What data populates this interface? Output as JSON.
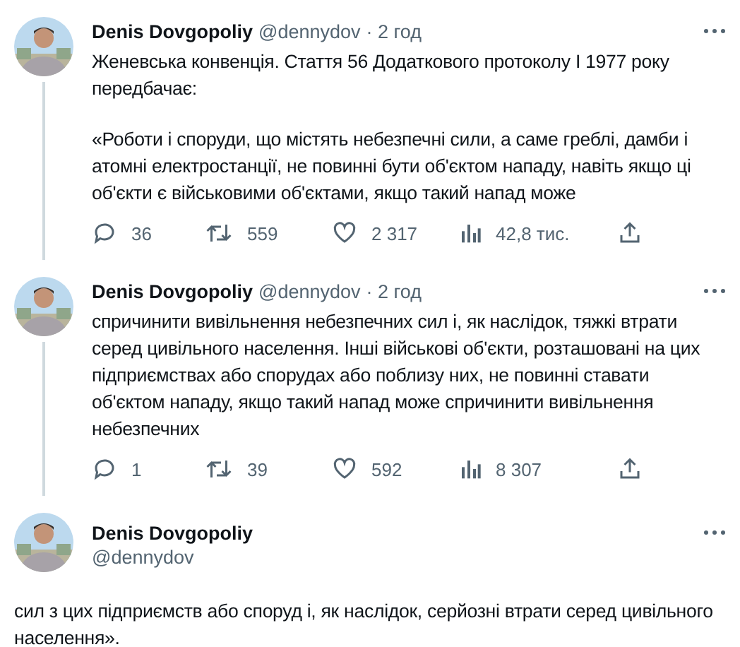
{
  "tweets": [
    {
      "kind": "thread",
      "author": {
        "name": "Denis Dovgopoliy",
        "handle": "@dennydov",
        "time": "· 2 год"
      },
      "paragraphs": [
        "Женевська конвенція. Стаття 56 Додаткового протоколу I 1977 року передбачає:",
        "«Роботи і споруди, що містять небезпечні сили, а саме греблі, дамби і атомні електростанції, не повинні бути об'єктом нападу, навіть якщо ці об'єкти є військовими об'єктами, якщо такий напад може"
      ],
      "actions": [
        {
          "kind": "reply",
          "count": "36"
        },
        {
          "kind": "retweet",
          "count": "559"
        },
        {
          "kind": "like",
          "count": "2 317"
        },
        {
          "kind": "views",
          "count": "42,8 тис."
        },
        {
          "kind": "share"
        }
      ]
    },
    {
      "kind": "thread",
      "author": {
        "name": "Denis Dovgopoliy",
        "handle": "@dennydov",
        "time": "· 2 год"
      },
      "paragraphs": [
        "спричинити вивільнення небезпечних сил і, як наслідок, тяжкі втрати серед цивільного населення. Інші військові об'єкти, розташовані на цих підприємствах або спорудах або поблизу них, не повинні ставати об'єктом нападу, якщо такий напад може спричинити вивільнення небезпечних"
      ],
      "actions": [
        {
          "kind": "reply",
          "count": "1"
        },
        {
          "kind": "retweet",
          "count": "39"
        },
        {
          "kind": "like",
          "count": "592"
        },
        {
          "kind": "views",
          "count": "8 307"
        },
        {
          "kind": "share"
        }
      ]
    },
    {
      "kind": "focused",
      "author": {
        "name": "Denis Dovgopoliy",
        "handle": "@dennydov"
      },
      "paragraphs": [
        "сил з цих підприємств або споруд і, як наслідок, серйозні втрати серед цивільного населення»."
      ]
    }
  ]
}
